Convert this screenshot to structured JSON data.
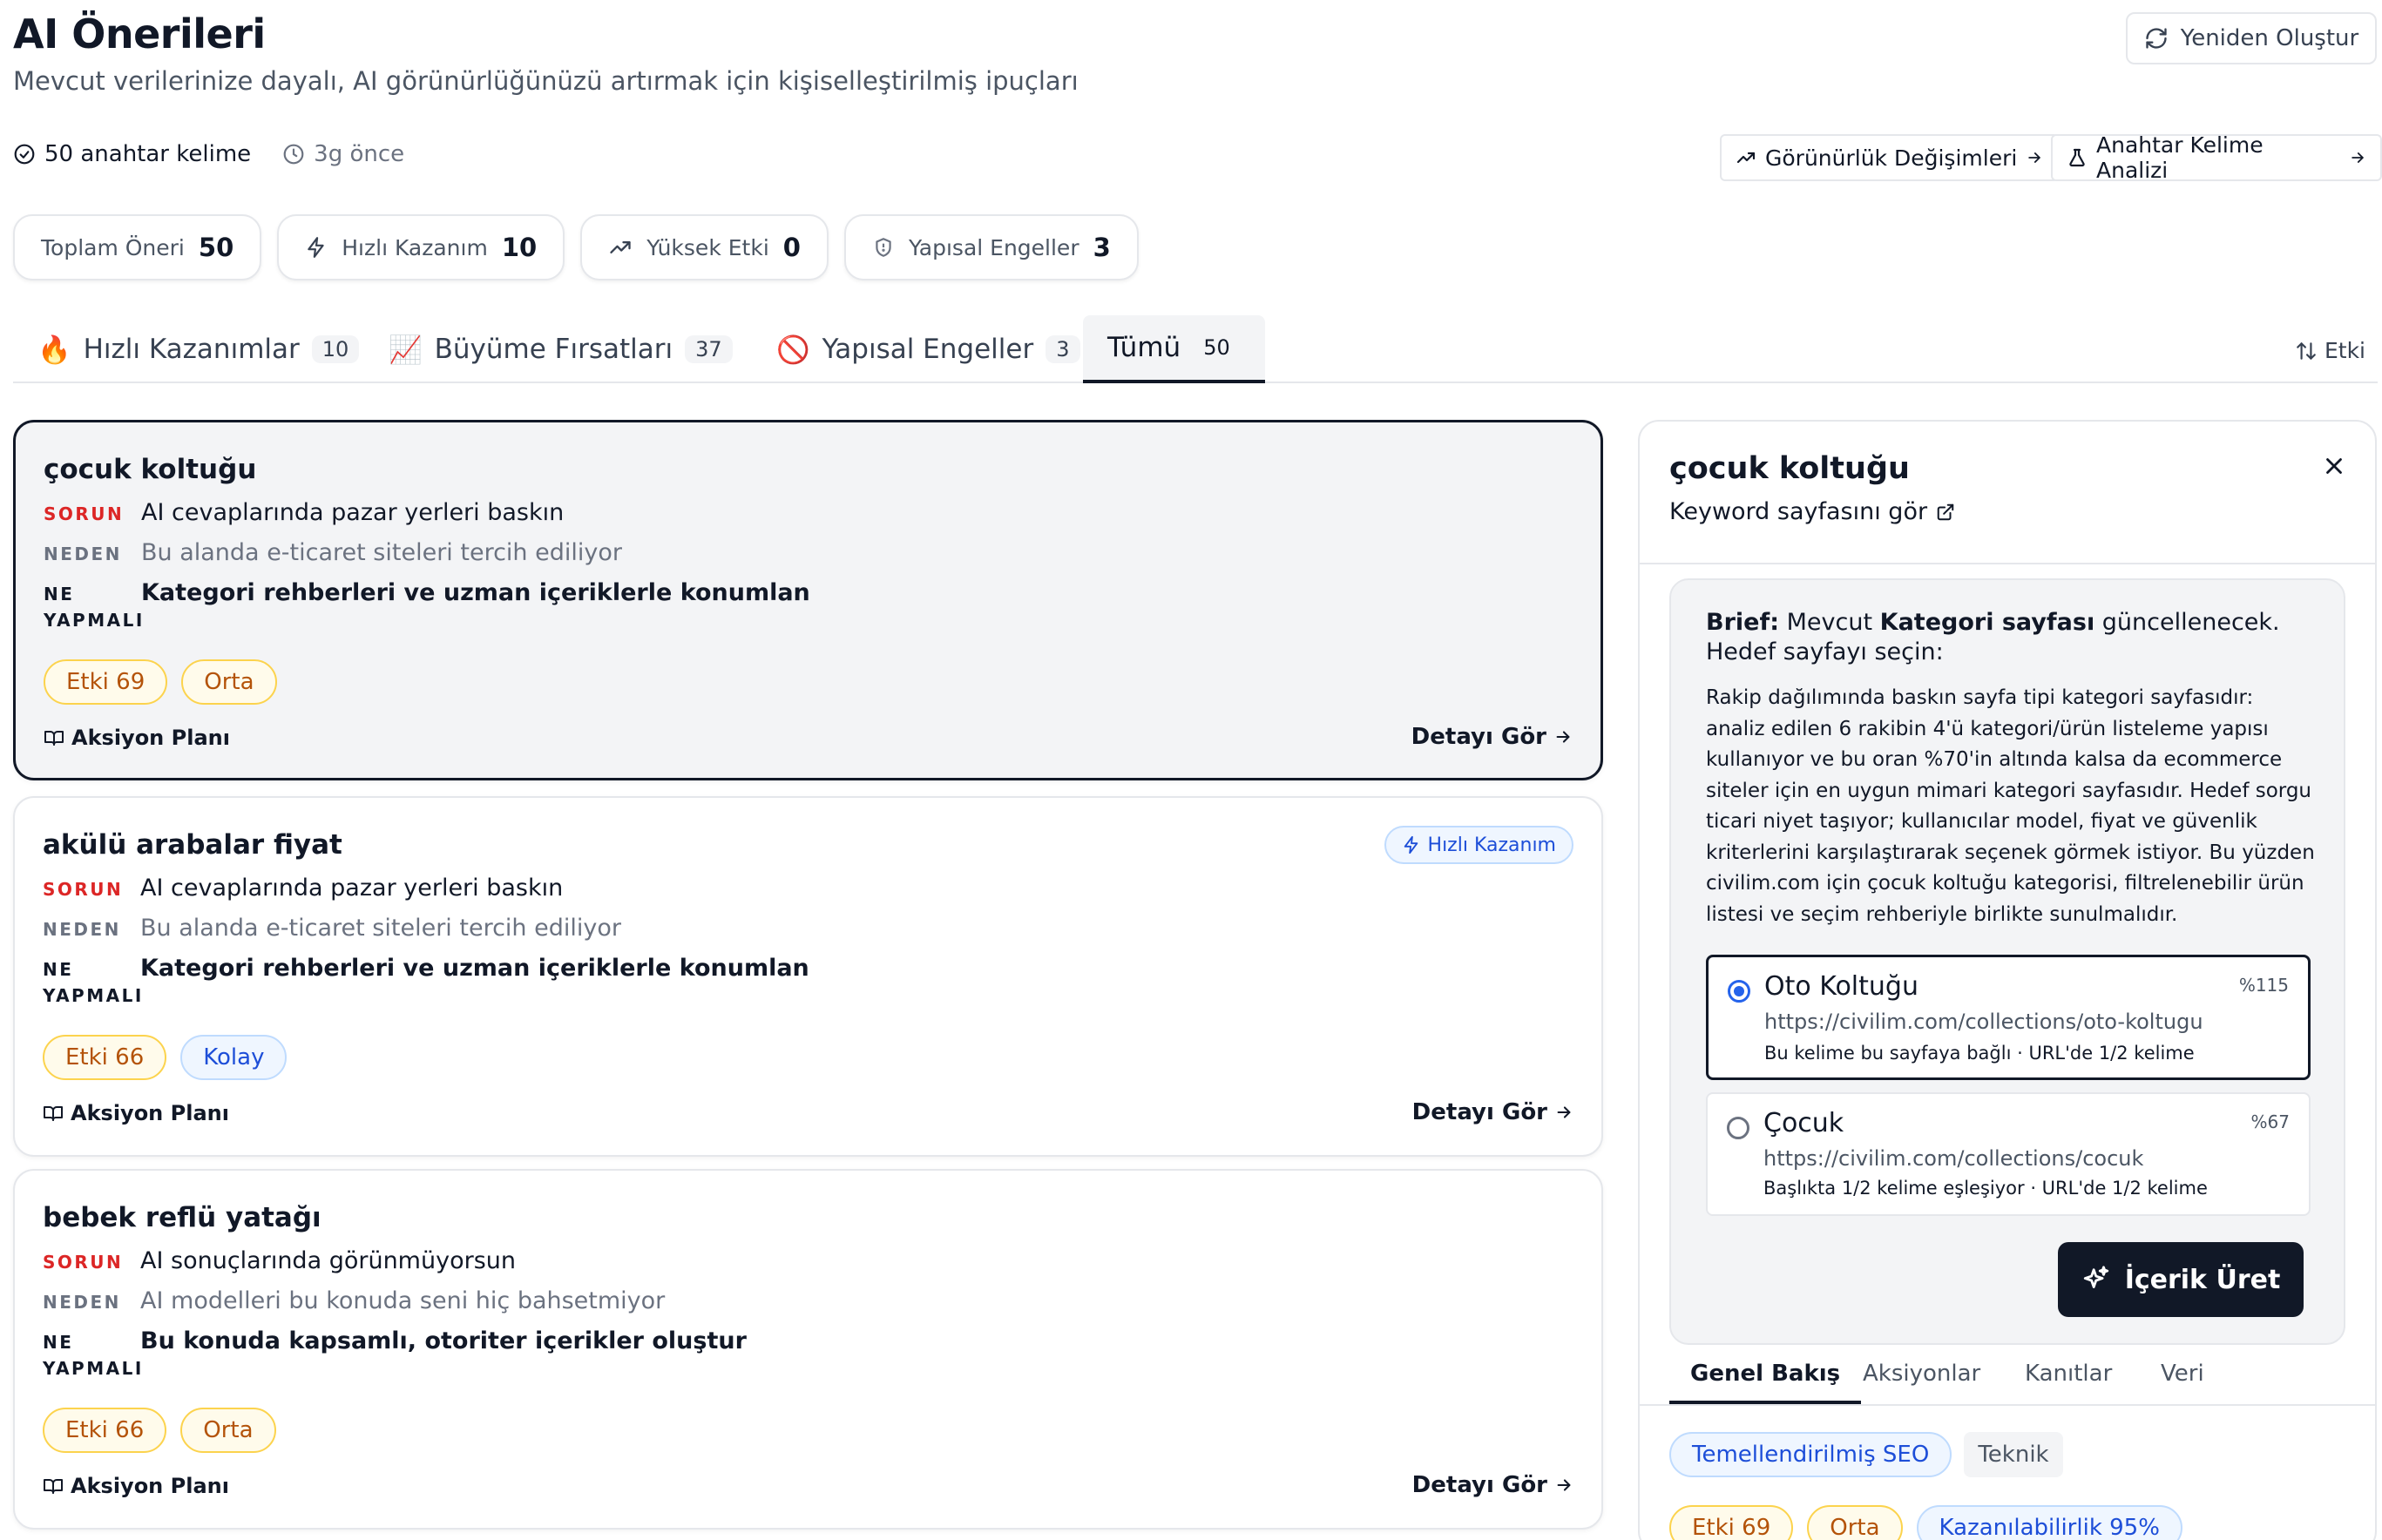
{
  "header": {
    "title": "AI Önerileri",
    "subtitle": "Mevcut verilerinize dayalı, AI görünürlüğünüzü artırmak için kişiselleştirilmiş ipuçları",
    "regenerate_label": "Yeniden Oluştur"
  },
  "meta": {
    "keywords": "50 anahtar kelime",
    "time": "3g önce",
    "visibility_link": "Görünürlük Değişimleri",
    "keyword_link": "Anahtar Kelime Analizi"
  },
  "stats": [
    {
      "label": "Toplam Öneri",
      "value": "50",
      "icon": "none"
    },
    {
      "label": "Hızlı Kazanım",
      "value": "10",
      "icon": "lightning-icon"
    },
    {
      "label": "Yüksek Etki",
      "value": "0",
      "icon": "trending-up-icon"
    },
    {
      "label": "Yapısal Engeller",
      "value": "3",
      "icon": "shield-icon"
    }
  ],
  "tabs": [
    {
      "emoji": "🔥",
      "label": "Hızlı Kazanımlar",
      "count": "10"
    },
    {
      "emoji": "📈",
      "label": "Büyüme Fırsatları",
      "count": "37"
    },
    {
      "emoji": "🚫",
      "label": "Yapısal Engeller",
      "count": "3"
    },
    {
      "emoji": "",
      "label": "Tümü",
      "count": "50"
    }
  ],
  "sort_label": "Etki",
  "labels": {
    "problem": "SORUN",
    "reason": "NEDEN",
    "todo_1": "NE",
    "todo_2": "YAPMALI",
    "action_plan": "Aksiyon Planı",
    "details": "Detayı Gör",
    "quick_badge": "Hızlı Kazanım"
  },
  "cards": [
    {
      "title": "çocuk koltuğu",
      "problem": "AI cevaplarında pazar yerleri baskın",
      "reason": "Bu alanda e-ticaret siteleri tercih ediliyor",
      "todo": "Kategori rehberleri ve uzman içeriklerle konumlan",
      "impact": "Etki 69",
      "difficulty": "Orta"
    },
    {
      "title": "akülü arabalar fiyat",
      "problem": "AI cevaplarında pazar yerleri baskın",
      "reason": "Bu alanda e-ticaret siteleri tercih ediliyor",
      "todo": "Kategori rehberleri ve uzman içeriklerle konumlan",
      "impact": "Etki 66",
      "difficulty": "Kolay"
    },
    {
      "title": "bebek reflü yatağı",
      "problem": "AI sonuçlarında görünmüyorsun",
      "reason": "AI modelleri bu konuda seni hiç bahsetmiyor",
      "todo": "Bu konuda kapsamlı, otoriter içerikler oluştur",
      "impact": "Etki 66",
      "difficulty": "Orta"
    }
  ],
  "panel": {
    "title": "çocuk koltuğu",
    "keyword_link": "Keyword sayfasını gör",
    "brief_label": "Brief:",
    "brief_pre": "Mevcut",
    "brief_bold": "Kategori sayfası",
    "brief_post": "güncellenecek. Hedef sayfayı seçin:",
    "brief_body": "Rakip dağılımında baskın sayfa tipi kategori sayfasıdır: analiz edilen 6 rakibin 4'ü kategori/ürün listeleme yapısı kullanıyor ve bu oran %70'in altında kalsa da ecommerce siteler için en uygun mimari kategori sayfasıdır. Hedef sorgu ticari niyet taşıyor; kullanıcılar model, fiyat ve güvenlik kriterlerini karşılaştırarak seçenek görmek istiyor. Bu yüzden civilim.com için çocuk koltuğu kategorisi, filtrelenebilir ürün listesi ve seçim rehberiyle birlikte sunulmalıdır.",
    "options": [
      {
        "name": "Oto Koltuğu",
        "url": "https://civilim.com/collections/oto-koltugu",
        "note": "Bu kelime bu sayfaya bağlı · URL'de 1/2 kelime",
        "pct": "%115",
        "selected": true
      },
      {
        "name": "Çocuk",
        "url": "https://civilim.com/collections/cocuk",
        "note": "Başlıkta 1/2 kelime eşleşiyor · URL'de 1/2 kelime",
        "pct": "%67",
        "selected": false
      }
    ],
    "generate_label": "İçerik Üret",
    "tabs": [
      "Genel Bakış",
      "Aksiyonlar",
      "Kanıtlar",
      "Veri"
    ],
    "tags": [
      "Temellendirilmiş SEO",
      "Teknik"
    ],
    "pills": [
      "Etki 69",
      "Orta",
      "Kazanılabilirlik 95%"
    ]
  }
}
